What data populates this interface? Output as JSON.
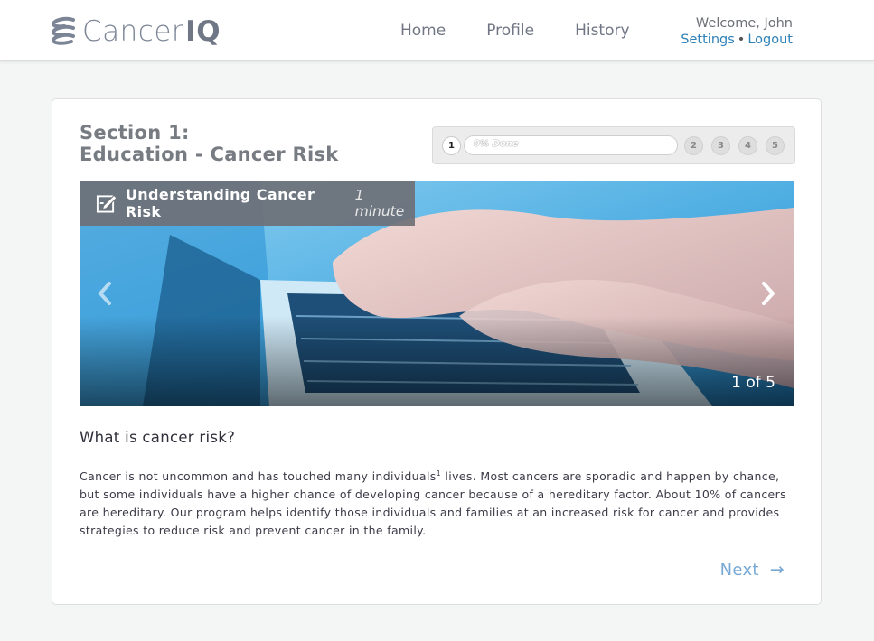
{
  "brand": {
    "name_light": "Cancer",
    "name_bold": "IQ",
    "logo_icon": "stacked-s-logo-icon"
  },
  "nav": {
    "items": [
      {
        "label": "Home"
      },
      {
        "label": "Profile"
      },
      {
        "label": "History"
      }
    ]
  },
  "user": {
    "welcome": "Welcome, John",
    "settings": "Settings",
    "separator": "•",
    "logout": "Logout"
  },
  "section": {
    "line1": "Section 1:",
    "line2": "Education - Cancer Risk"
  },
  "progress": {
    "steps": [
      "1",
      "2",
      "3",
      "4",
      "5"
    ],
    "current": "1",
    "percent_label": "0% Done",
    "percent": 0
  },
  "hero": {
    "caption_title": "Understanding Cancer Risk",
    "caption_time": "1 minute",
    "counter": "1 of 5",
    "icons": {
      "caption": "edit-icon",
      "prev": "chevron-left-icon",
      "next": "chevron-right-icon"
    }
  },
  "content": {
    "question": "What is cancer risk?",
    "para_part1": "Cancer is not uncommon and has touched many individuals",
    "para_sup": "1",
    "para_part2": " lives. Most cancers are sporadic and happen by chance, but some individuals have a higher chance of developing cancer because of a hereditary factor. About 10% of cancers are hereditary. Our program helps identify those individuals and families at an increased risk for cancer and provides strategies to reduce risk and prevent cancer in the family."
  },
  "actions": {
    "next_label": "Next",
    "next_arrow": "→"
  },
  "colors": {
    "accent": "#2f80b7",
    "next": "#78a9d4",
    "caption_bg": "#6e7076"
  }
}
